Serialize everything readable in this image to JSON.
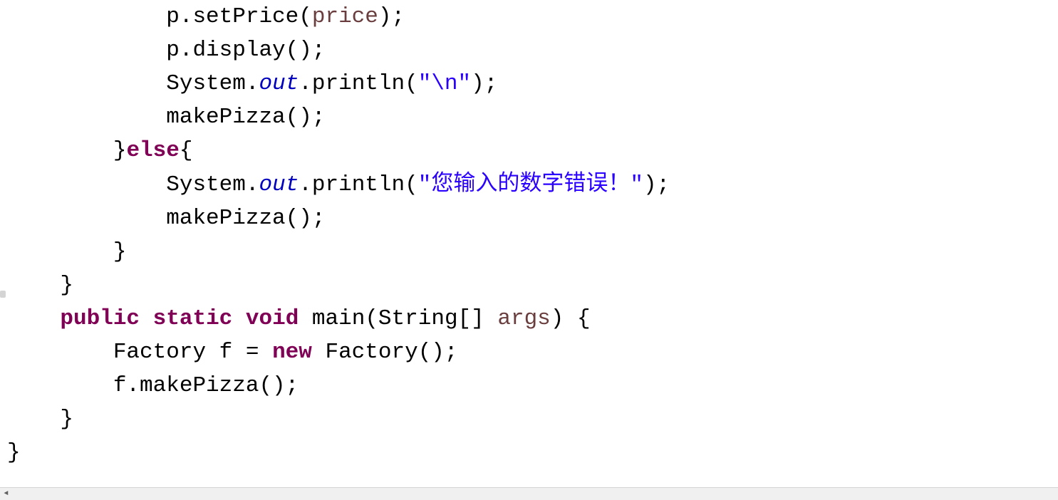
{
  "code": {
    "line1_part1": "            p.setPrice(",
    "line1_var": "price",
    "line1_part2": ");",
    "line2": "            p.display();",
    "line3_part1": "            System.",
    "line3_out": "out",
    "line3_part2": ".println(",
    "line3_str": "\"\\n\"",
    "line3_part3": ");",
    "line4": "            makePizza();",
    "line5_part1": "        }",
    "line5_else": "else",
    "line5_part2": "{",
    "line6_part1": "            System.",
    "line6_out": "out",
    "line6_part2": ".println(",
    "line6_str": "\"您输入的数字错误！\"",
    "line6_part3": ");",
    "line7": "            makePizza();",
    "line8": "        }",
    "line9": "    }",
    "line10_kw1": "public",
    "line10_sp1": " ",
    "line10_kw2": "static",
    "line10_sp2": " ",
    "line10_kw3": "void",
    "line10_part2": " main(String[] ",
    "line10_args": "args",
    "line10_part3": ") {",
    "line11_part1": "        Factory f = ",
    "line11_new": "new",
    "line11_part2": " Factory();",
    "line12": "        f.makePizza();",
    "line13": "    }",
    "line14": "}"
  },
  "scroll": {
    "arrow_left": "◄"
  }
}
